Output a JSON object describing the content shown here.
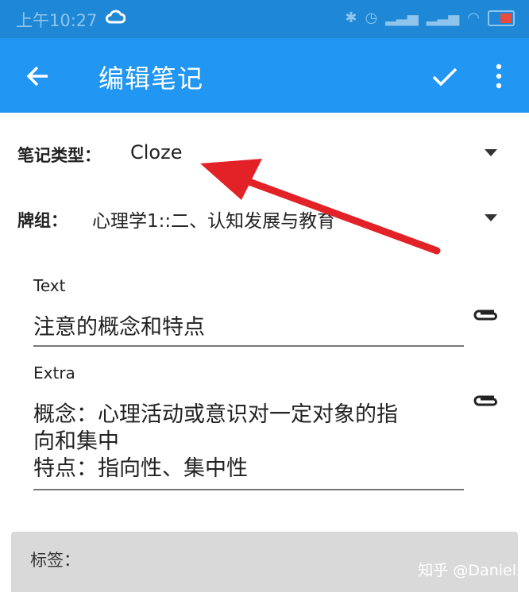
{
  "status_bar": {
    "time": "上午10:27",
    "icons": [
      "cloud-icon",
      "bluetooth-icon",
      "alarm-icon",
      "signal-icon",
      "signal-icon",
      "wifi-icon",
      "battery-icon"
    ]
  },
  "app_bar": {
    "title": "编辑笔记",
    "back_icon": "arrow-left-icon",
    "confirm_icon": "check-icon",
    "more_icon": "more-vert-icon"
  },
  "note_type": {
    "label": "笔记类型：",
    "value": "Cloze"
  },
  "deck": {
    "label": "牌组：",
    "value": "心理学1::二、认知发展与教育"
  },
  "fields": [
    {
      "label": "Text",
      "value": "注意的概念和特点"
    },
    {
      "label": "Extra",
      "value": "概念：心理活动或意识对一定对象的指\n向和集中\n特点：指向性、集中性"
    }
  ],
  "tags": {
    "label": "标签："
  },
  "watermark": "知乎 @Daniel",
  "colors": {
    "app_bar": "#2196f3",
    "status_bar": "#1e88d6",
    "annotation_arrow": "#e32227"
  }
}
